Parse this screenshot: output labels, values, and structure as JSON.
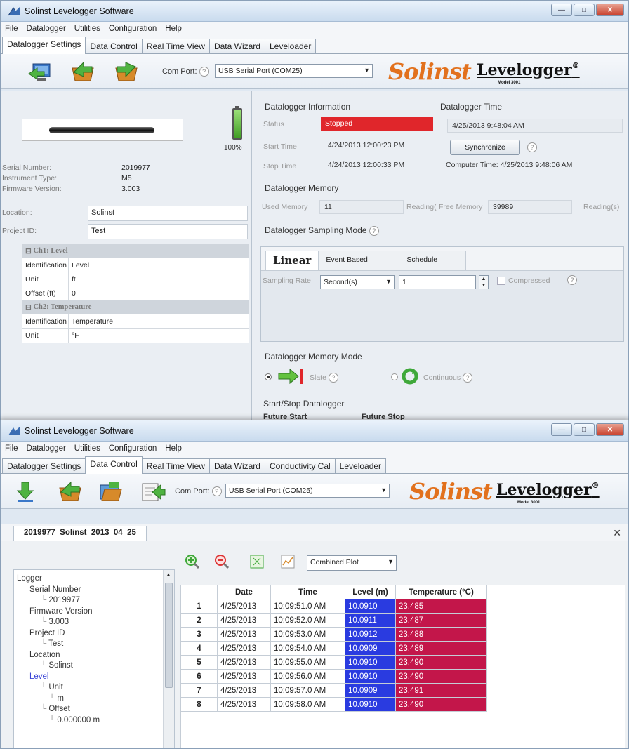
{
  "colors": {
    "accent_orange": "#e2711d",
    "status_red": "#e0262b",
    "level_blue": "#2a3be0",
    "temp_crimson": "#c3164a"
  },
  "window1": {
    "title": "Solinst Levelogger Software",
    "menu": [
      "File",
      "Datalogger",
      "Utilities",
      "Configuration",
      "Help"
    ],
    "tabs": [
      "Datalogger Settings",
      "Data Control",
      "Real Time View",
      "Data Wizard",
      "Leveloader"
    ],
    "com_port_label": "Com Port:",
    "com_port_value": "USB Serial Port (COM25)",
    "brand": {
      "solinst": "Solinst",
      "levelogger": "Levelogger",
      "registered": "®",
      "model": "Model 3001"
    },
    "device": {
      "battery": "100%",
      "info": [
        {
          "label": "Serial Number:",
          "value": "2019977"
        },
        {
          "label": "Instrument Type:",
          "value": "M5"
        },
        {
          "label": "Firmware Version:",
          "value": "3.003"
        }
      ],
      "location_label": "Location:",
      "location_value": "Solinst",
      "project_label": "Project ID:",
      "project_value": "Test"
    },
    "channels": {
      "ch1_header": "Ch1: Level",
      "ch1_rows": [
        {
          "k": "Identification",
          "v": "Level"
        },
        {
          "k": "Unit",
          "v": "ft"
        },
        {
          "k": "Offset (ft)",
          "v": "0"
        }
      ],
      "ch2_header": "Ch2: Temperature",
      "ch2_rows": [
        {
          "k": "Identification",
          "v": "Temperature"
        },
        {
          "k": "Unit",
          "v": "°F"
        }
      ]
    },
    "info": {
      "title": "Datalogger Information",
      "status_label": "Status",
      "status_value": "Stopped",
      "start_label": "Start Time",
      "start_value": "4/24/2013 12:00:23 PM",
      "stop_label": "Stop Time",
      "stop_value": "4/24/2013 12:00:33 PM"
    },
    "time": {
      "title": "Datalogger Time",
      "value": "4/25/2013 9:48:04 AM",
      "sync": "Synchronize",
      "computer_time": "Computer Time: 4/25/2013 9:48:06 AM"
    },
    "memory": {
      "title": "Datalogger Memory",
      "used_label": "Used Memory",
      "used_value": "11",
      "used_unit": "Reading(",
      "free_label": "Free Memory",
      "free_value": "39989",
      "free_unit": "Reading(s)"
    },
    "sampling": {
      "title": "Datalogger Sampling Mode",
      "tabs": [
        "Linear",
        "Event Based",
        "Schedule"
      ],
      "rate_label": "Sampling Rate",
      "rate_unit": "Second(s)",
      "rate_value": "1",
      "compressed": "Compressed"
    },
    "memory_mode": {
      "title": "Datalogger Memory Mode",
      "slate": "Slate",
      "continuous": "Continuous"
    },
    "startstop": {
      "title": "Start/Stop Datalogger",
      "future_start": "Future Start",
      "future_stop": "Future Stop"
    }
  },
  "window2": {
    "title": "Solinst Levelogger Software",
    "menu": [
      "File",
      "Datalogger",
      "Utilities",
      "Configuration",
      "Help"
    ],
    "tabs": [
      "Datalogger Settings",
      "Data Control",
      "Real Time View",
      "Data Wizard",
      "Conductivity Cal",
      "Leveloader"
    ],
    "com_port_label": "Com Port:",
    "com_port_value": "USB Serial Port (COM25)",
    "file_tab": "2019977_Solinst_2013_04_25",
    "plot_select": "Combined Plot",
    "tree": [
      {
        "label": "Logger",
        "indent": 0
      },
      {
        "label": "Serial Number",
        "indent": 1
      },
      {
        "label": "2019977",
        "indent": 2
      },
      {
        "label": "Firmware Version",
        "indent": 1
      },
      {
        "label": "3.003",
        "indent": 2
      },
      {
        "label": "Project ID",
        "indent": 1
      },
      {
        "label": "Test",
        "indent": 2
      },
      {
        "label": "Location",
        "indent": 1
      },
      {
        "label": "Solinst",
        "indent": 2
      },
      {
        "label": "Level",
        "indent": 1,
        "highlight": true
      },
      {
        "label": "Unit",
        "indent": 2
      },
      {
        "label": "m",
        "indent": 3
      },
      {
        "label": "Offset",
        "indent": 2
      },
      {
        "label": "0.000000 m",
        "indent": 3
      }
    ],
    "table": {
      "headers": [
        "",
        "Date",
        "Time",
        "Level (m)",
        "Temperature (°C)"
      ],
      "rows": [
        [
          "1",
          "4/25/2013",
          "10:09:51.0 AM",
          "10.0910",
          "23.485"
        ],
        [
          "2",
          "4/25/2013",
          "10:09:52.0 AM",
          "10.0911",
          "23.487"
        ],
        [
          "3",
          "4/25/2013",
          "10:09:53.0 AM",
          "10.0912",
          "23.488"
        ],
        [
          "4",
          "4/25/2013",
          "10:09:54.0 AM",
          "10.0909",
          "23.489"
        ],
        [
          "5",
          "4/25/2013",
          "10:09:55.0 AM",
          "10.0910",
          "23.490"
        ],
        [
          "6",
          "4/25/2013",
          "10:09:56.0 AM",
          "10.0910",
          "23.490"
        ],
        [
          "7",
          "4/25/2013",
          "10:09:57.0 AM",
          "10.0909",
          "23.491"
        ],
        [
          "8",
          "4/25/2013",
          "10:09:58.0 AM",
          "10.0910",
          "23.490"
        ]
      ]
    }
  }
}
